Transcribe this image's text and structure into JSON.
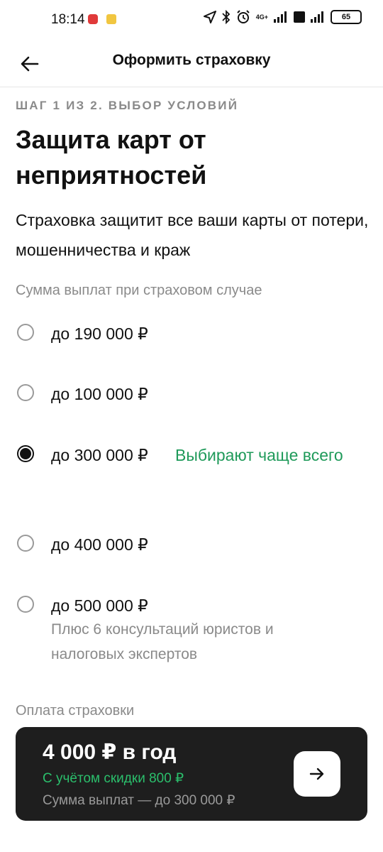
{
  "status_bar": {
    "time": "18:14",
    "network": "4G+",
    "battery": "65"
  },
  "header": {
    "title": "Оформить страховку"
  },
  "step_label": "ШАГ 1 ИЗ 2. ВЫБОР УСЛОВИЙ",
  "title": "Защита карт от неприятностей",
  "subtitle": "Страховка защитит все ваши карты от потери, мошенничества и краж",
  "payout_section": {
    "label": "Сумма выплат при страховом случае",
    "options": [
      {
        "label": "до 190 000 ₽",
        "selected": false
      },
      {
        "label": "до 100 000 ₽",
        "selected": false
      },
      {
        "label": "до 300 000 ₽",
        "selected": true,
        "badge": "Выбирают чаще всего"
      },
      {
        "label": "до 400 000 ₽",
        "selected": false
      },
      {
        "label": "до 500 000 ₽",
        "selected": false,
        "note": "Плюс 6 консультаций юристов и налоговых экспертов"
      }
    ]
  },
  "payment": {
    "label": "Оплата страховки",
    "price": "4 000 ₽ в год",
    "discount": "С учётом скидки 800 ₽",
    "sum": "Сумма выплат — до 300 000 ₽"
  },
  "colors": {
    "accent_green": "#1f9a5a",
    "card_bg": "#1e1e1e",
    "muted_text": "#8a8a8a"
  }
}
